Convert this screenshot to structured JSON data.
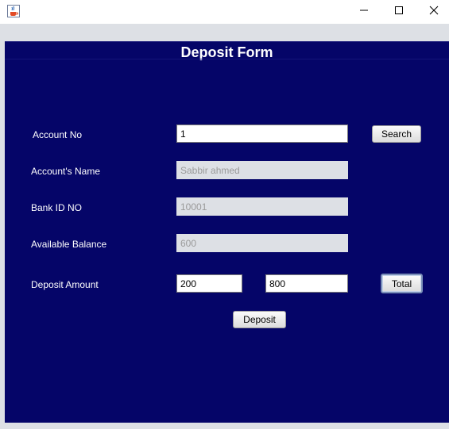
{
  "window": {
    "controls": {
      "minimize_icon": "minimize-icon",
      "maximize_icon": "maximize-icon",
      "close_icon": "close-icon"
    },
    "app_icon": "java-cup-icon"
  },
  "form": {
    "title": "Deposit Form",
    "account_no": {
      "label": "Account No",
      "value": "1"
    },
    "search_button": "Search",
    "account_name": {
      "label": "Account's Name",
      "value": "Sabbir ahmed"
    },
    "bank_id": {
      "label": "Bank ID NO",
      "value": "10001"
    },
    "available_balance": {
      "label": "Available Balance",
      "value": "600"
    },
    "deposit_amount": {
      "label": "Deposit Amount",
      "value": "200",
      "total_value": "800"
    },
    "total_button": "Total",
    "deposit_button": "Deposit"
  },
  "colors": {
    "panel_background": "#050568",
    "frame_background": "#dde0e5",
    "label_text": "#ffffff",
    "readonly_field": "#dde0e5"
  }
}
